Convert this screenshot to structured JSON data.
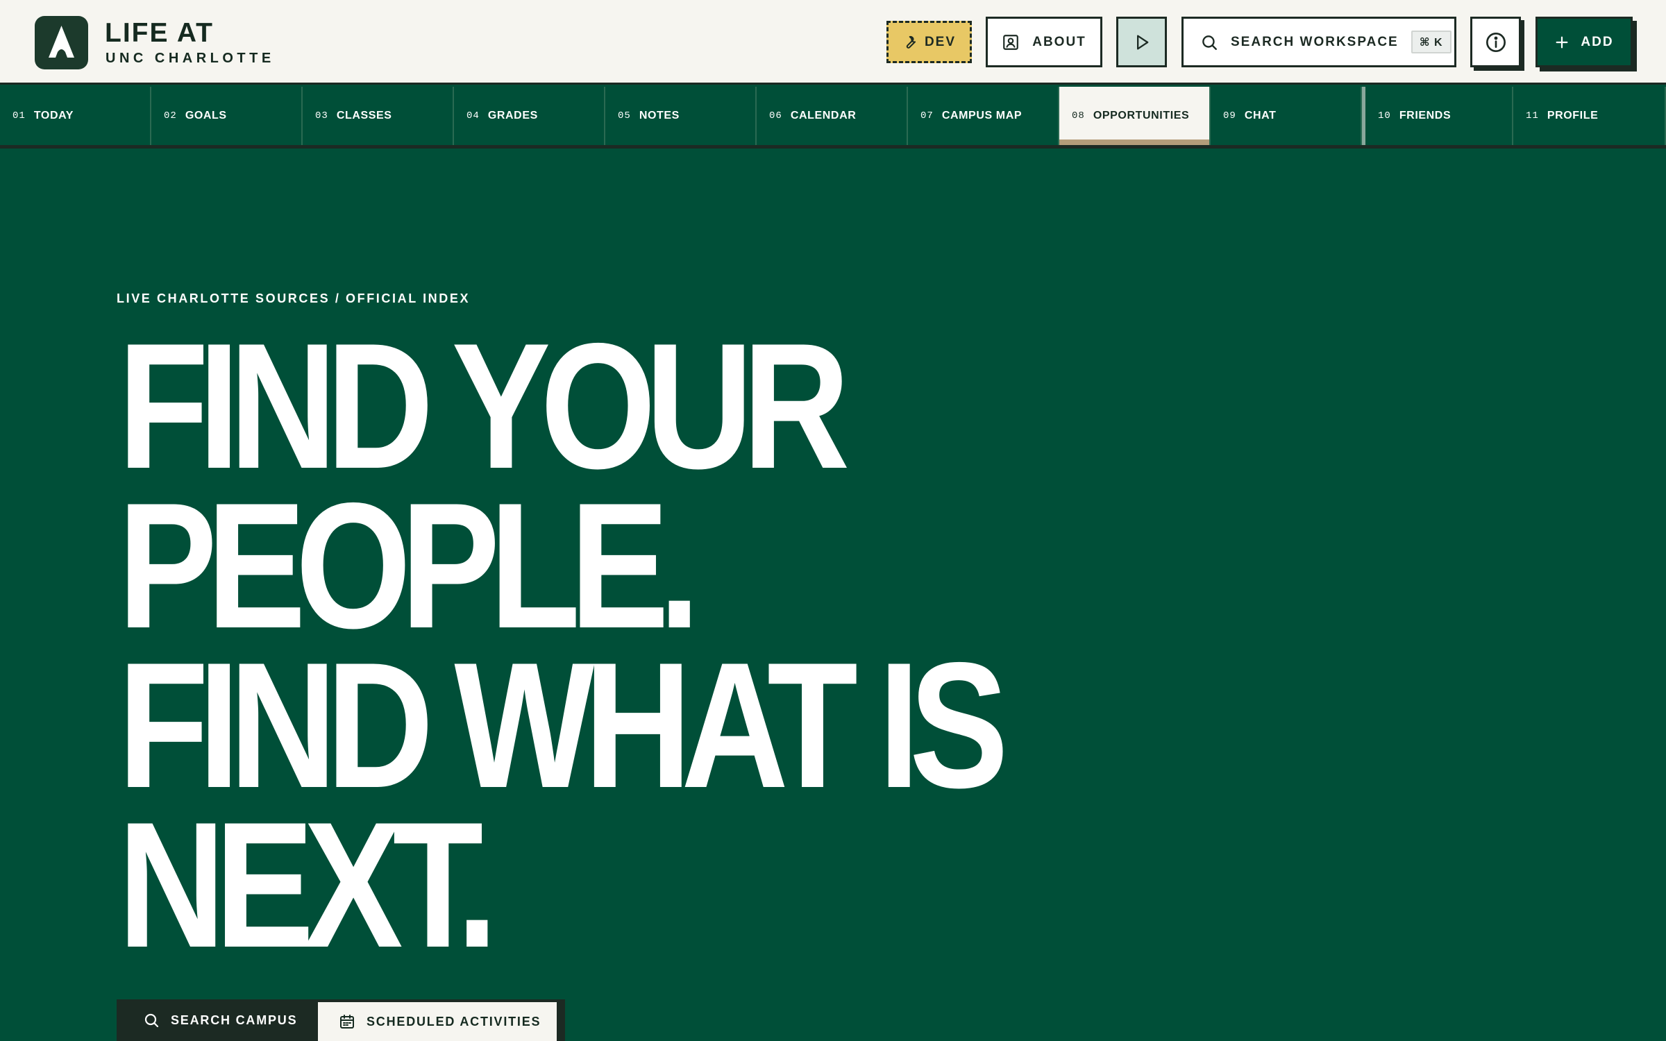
{
  "brand": {
    "title": "LIFE AT",
    "subtitle": "UNC CHARLOTTE",
    "logo_icon": "arch-logo-icon"
  },
  "header": {
    "dev_label": "DEV",
    "about_label": "ABOUT",
    "search_label": "SEARCH WORKSPACE",
    "search_shortcut": "⌘ K",
    "add_label": "ADD",
    "icons": {
      "dev": "wrench-icon",
      "about": "id-badge-icon",
      "play": "play-icon",
      "search": "search-icon",
      "info": "info-icon",
      "add": "plus-icon"
    }
  },
  "nav": {
    "active_index": 7,
    "tabs": [
      {
        "num": "01",
        "label": "TODAY"
      },
      {
        "num": "02",
        "label": "GOALS"
      },
      {
        "num": "03",
        "label": "CLASSES"
      },
      {
        "num": "04",
        "label": "GRADES"
      },
      {
        "num": "05",
        "label": "NOTES"
      },
      {
        "num": "06",
        "label": "CALENDAR"
      },
      {
        "num": "07",
        "label": "CAMPUS MAP"
      },
      {
        "num": "08",
        "label": "OPPORTUNITIES"
      },
      {
        "num": "09",
        "label": "CHAT"
      },
      {
        "num": "10",
        "label": "FRIENDS"
      },
      {
        "num": "11",
        "label": "PROFILE"
      }
    ]
  },
  "hero": {
    "eyebrow": "LIVE CHARLOTTE SOURCES / OFFICIAL INDEX",
    "lines": [
      "FIND YOUR",
      "PEOPLE.",
      "FIND WHAT IS",
      "NEXT."
    ],
    "cta_search": "SEARCH CAMPUS",
    "cta_activities": "SCHEDULED ACTIVITIES"
  },
  "colors": {
    "brand_green": "#004f38",
    "cream": "#f6f5f0",
    "ink": "#1c2a23",
    "dev_yellow": "#e8c865",
    "active_underline": "#b49d7a"
  }
}
